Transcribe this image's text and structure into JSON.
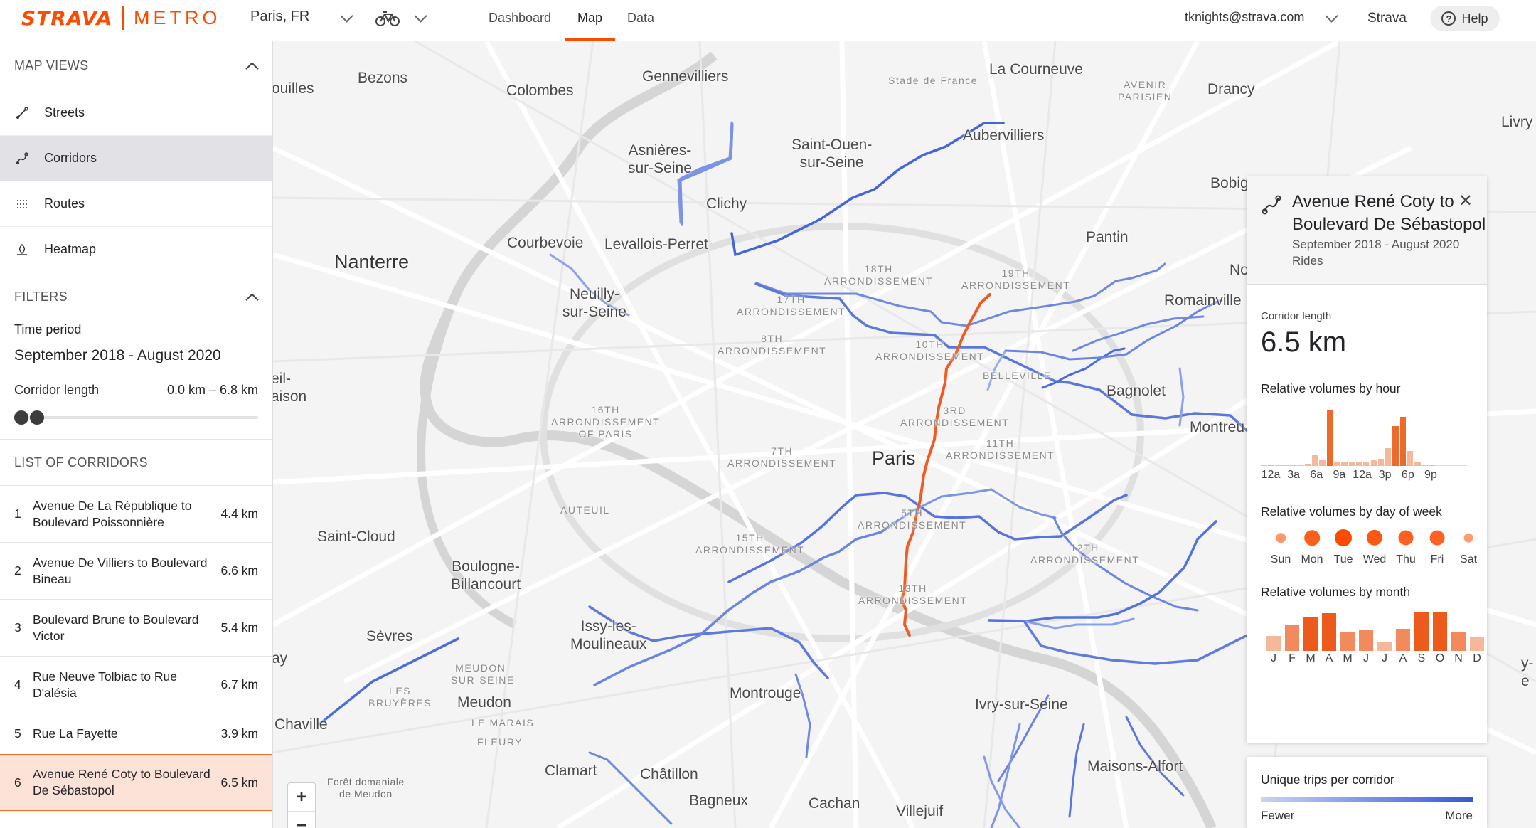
{
  "header": {
    "logo_primary": "STRAVA",
    "logo_secondary": "METRO",
    "city": "Paris, FR",
    "activity_icon": "bike-icon",
    "nav": [
      {
        "label": "Dashboard",
        "active": false
      },
      {
        "label": "Map",
        "active": true
      },
      {
        "label": "Data",
        "active": false
      }
    ],
    "user_email": "tknights@strava.com",
    "strava_link": "Strava",
    "help_label": "Help",
    "accent_color": "#fc4c02"
  },
  "sidebar": {
    "map_views_heading": "MAP VIEWS",
    "views": [
      {
        "label": "Streets",
        "icon": "streets-icon",
        "active": false
      },
      {
        "label": "Corridors",
        "icon": "corridors-icon",
        "active": true
      },
      {
        "label": "Routes",
        "icon": "routes-icon",
        "active": false
      },
      {
        "label": "Heatmap",
        "icon": "heatmap-icon",
        "active": false
      }
    ],
    "filters_heading": "FILTERS",
    "time_period_label": "Time period",
    "time_period_value": "September 2018 - August 2020",
    "corridor_length_label": "Corridor length",
    "corridor_length_range": "0.0 km – 6.8 km",
    "list_heading": "LIST OF CORRIDORS",
    "corridors": [
      {
        "num": "1",
        "name": "Avenue De La République to Boulevard Poissonnière",
        "km": "4.4 km"
      },
      {
        "num": "2",
        "name": "Avenue De Villiers to Boulevard Bineau",
        "km": "6.6 km"
      },
      {
        "num": "3",
        "name": "Boulevard Brune to Boulevard Victor",
        "km": "5.4 km"
      },
      {
        "num": "4",
        "name": "Rue Neuve Tolbiac to Rue D'alésia",
        "km": "6.7 km"
      },
      {
        "num": "5",
        "name": "Rue La Fayette",
        "km": "3.9 km"
      },
      {
        "num": "6",
        "name": "Avenue René Coty to Boulevard De Sébastopol",
        "km": "6.5 km"
      }
    ]
  },
  "map": {
    "places": {
      "bezons": "Bezons",
      "ouilles": "ouilles",
      "colombes": "Colombes",
      "gennevilliers": "Gennevilliers",
      "stade": "Stade de France",
      "courneuve": "La Courneuve",
      "avenir": "AVENIR\nPARISIEN",
      "drancy": "Drancy",
      "livry": "Livry",
      "asnieres": "Asnières-\nsur-Seine",
      "saintouen": "Saint-Ouen-\nsur-Seine",
      "aubervilliers": "Aubervilliers",
      "bobigny": "Bobig",
      "clichy": "Clichy",
      "courbevoie": "Courbevoie",
      "levallois": "Levallois-Perret",
      "pantin": "Pantin",
      "nanterre": "Nanterre",
      "arr18": "18TH\nARRONDISSEMENT",
      "arr19": "19TH\nARRONDISSEMENT",
      "noisy": "No",
      "neuilly": "Neuilly-\nsur-Seine",
      "arr17": "17TH\nARRONDISSEMENT",
      "romainville": "Romainville",
      "arr8": "8TH\nARRONDISSEMENT",
      "arr10": "10TH\nARRONDISSEMENT",
      "belleville": "BELLEVILLE",
      "rueil": "eil-\naison",
      "bagnolet": "Bagnolet",
      "arr16": "16TH\nARRONDISSEMENT\nOF PARIS",
      "arr3": "3RD\nARRONDISSEMENT",
      "montreuil": "Montreu",
      "arr7": "7TH\nARRONDISSEMENT",
      "paris": "Paris",
      "arr11": "11TH\nARRONDISSEMENT",
      "auteuil": "AUTEUIL",
      "arr5": "5TH\nARRONDISSEMENT",
      "saintcloud": "Saint-Cloud",
      "arr15": "15TH\nARRONDISSEMENT",
      "arr12": "12TH\nARRONDISSEMENT",
      "boulogne": "Boulogne-\nBillancourt",
      "arr13": "13TH\nARRONDISSEMENT",
      "issy": "Issy-les-\nMoulineaux",
      "sevres": "Sèvres",
      "ay": "ay",
      "meudonseine": "MEUDON-\nSUR-SEINE",
      "bruyeres": "LES\nBRUYÈRES",
      "meudon": "Meudon",
      "montrouge": "Montrouge",
      "ivry": "Ivry-sur-Seine",
      "chaville": "Chaville",
      "lemarais": "LE MARAIS",
      "fleury": "FLEURY",
      "clamart": "Clamart",
      "maisons": "Maisons-Alfort",
      "foret": "Forêt domaniale\nde Meudon",
      "chatillon": "Châtillon",
      "bagneux": "Bagneux",
      "cachan": "Cachan",
      "villejuif": "Villejuif",
      "edge_y": "y-\ne"
    },
    "zoom_in": "+",
    "zoom_out": "−",
    "selected_color": "#f15a22",
    "corridor_color": "#3d5fd6"
  },
  "panel": {
    "icon": "corridors-icon",
    "title": "Avenue René Coty to Boulevard De Sébastopol",
    "period": "September 2018 - August 2020",
    "activity": "Rides",
    "close_icon": "close-icon",
    "length_label": "Corridor length",
    "length_value": "6.5 km",
    "hour_heading": "Relative volumes by hour",
    "hour_values": [
      0.02,
      0.01,
      0.01,
      0.01,
      0.01,
      0.02,
      0.04,
      0.18,
      0.1,
      0.95,
      0.06,
      0.06,
      0.06,
      0.07,
      0.06,
      0.1,
      0.12,
      0.3,
      0.68,
      0.84,
      0.26,
      0.06,
      0.03,
      0.02
    ],
    "hour_labels": [
      "12a",
      "3a",
      "6a",
      "9a",
      "12a",
      "3p",
      "6p",
      "9p"
    ],
    "dow_heading": "Relative volumes by day of week",
    "dow": [
      {
        "day": "Sun",
        "value": 0.35
      },
      {
        "day": "Mon",
        "value": 0.85
      },
      {
        "day": "Tue",
        "value": 1.0
      },
      {
        "day": "Wed",
        "value": 0.9
      },
      {
        "day": "Thu",
        "value": 0.82
      },
      {
        "day": "Fri",
        "value": 0.8
      },
      {
        "day": "Sat",
        "value": 0.3
      }
    ],
    "month_heading": "Relative volumes by month",
    "months": [
      {
        "m": "J",
        "value": 0.35
      },
      {
        "m": "F",
        "value": 0.62
      },
      {
        "m": "M",
        "value": 0.8
      },
      {
        "m": "A",
        "value": 0.88
      },
      {
        "m": "M",
        "value": 0.45
      },
      {
        "m": "J",
        "value": 0.5
      },
      {
        "m": "J",
        "value": 0.2
      },
      {
        "m": "A",
        "value": 0.52
      },
      {
        "m": "S",
        "value": 0.9
      },
      {
        "m": "O",
        "value": 0.9
      },
      {
        "m": "N",
        "value": 0.44
      },
      {
        "m": "D",
        "value": 0.32
      }
    ]
  },
  "legend": {
    "title": "Unique trips per corridor",
    "low": "Fewer",
    "high": "More"
  }
}
